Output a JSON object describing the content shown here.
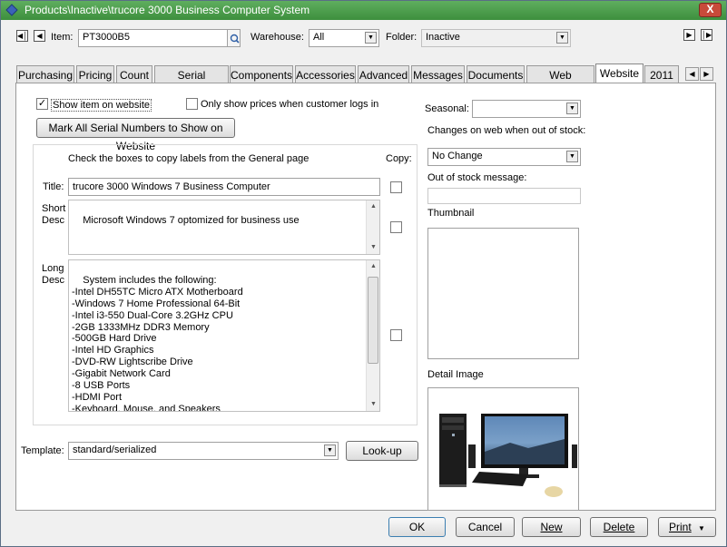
{
  "window": {
    "title": "Products\\Inactive\\trucore 3000 Business Computer System",
    "close_glyph": "X"
  },
  "header": {
    "item_label": "Item:",
    "item_value": "PT3000B5",
    "warehouse_label": "Warehouse:",
    "warehouse_value": "All",
    "folder_label": "Folder:",
    "folder_value": "Inactive"
  },
  "tabs": [
    {
      "label": "Purchasing"
    },
    {
      "label": "Pricing"
    },
    {
      "label": "Count"
    },
    {
      "label": "Serial Numbers"
    },
    {
      "label": "Components"
    },
    {
      "label": "Accessories"
    },
    {
      "label": "Advanced"
    },
    {
      "label": "Messages"
    },
    {
      "label": "Documents"
    },
    {
      "label": "Web Reviews"
    },
    {
      "label": "Website"
    },
    {
      "label": "2011"
    }
  ],
  "active_tab": "Website",
  "website": {
    "show_on_website_label": "Show item on website",
    "show_on_website_checked": true,
    "only_prices_login_label": "Only show prices when customer logs in",
    "only_prices_login_checked": false,
    "mark_serials_button": "Mark All Serial Numbers to Show on Website",
    "copy_instructions": "Check the boxes to copy labels from the General page",
    "copy_label": "Copy:",
    "title_label": "Title:",
    "title_value": "trucore 3000 Windows 7 Business Computer",
    "short_desc_label_1": "Short",
    "short_desc_label_2": "Desc",
    "short_desc_value": "Microsoft Windows 7 optomized for business use",
    "long_desc_label_1": "Long",
    "long_desc_label_2": "Desc",
    "long_desc_value": "System includes the following:\n-Intel DH55TC Micro ATX Motherboard\n-Windows 7 Home Professional 64-Bit\n-Intel i3-550 Dual-Core 3.2GHz CPU\n-2GB 1333MHz DDR3 Memory\n-500GB Hard Drive\n-Intel HD Graphics\n-DVD-RW Lightscribe Drive\n-Gigabit Network Card\n-8 USB Ports\n-HDMI Port\n-Keyboard, Mouse, and Speakers",
    "template_label": "Template:",
    "template_value": "standard/serialized",
    "lookup_button": "Look-up",
    "seasonal_label": "Seasonal:",
    "seasonal_value": "",
    "out_of_stock_change_label": "Changes on web when out of stock:",
    "out_of_stock_change_value": "No Change",
    "out_of_stock_msg_label": "Out of stock message:",
    "out_of_stock_msg_value": "",
    "thumbnail_label": "Thumbnail",
    "detail_image_label": "Detail Image"
  },
  "footer": {
    "ok": "OK",
    "cancel": "Cancel",
    "new": "New",
    "delete": "Delete",
    "print": "Print"
  },
  "icons": {
    "first": "first-record-icon",
    "prev": "previous-record-icon",
    "next": "next-record-icon",
    "last": "last-record-icon",
    "search": "search-icon",
    "dropdown": "chevron-down-icon"
  }
}
